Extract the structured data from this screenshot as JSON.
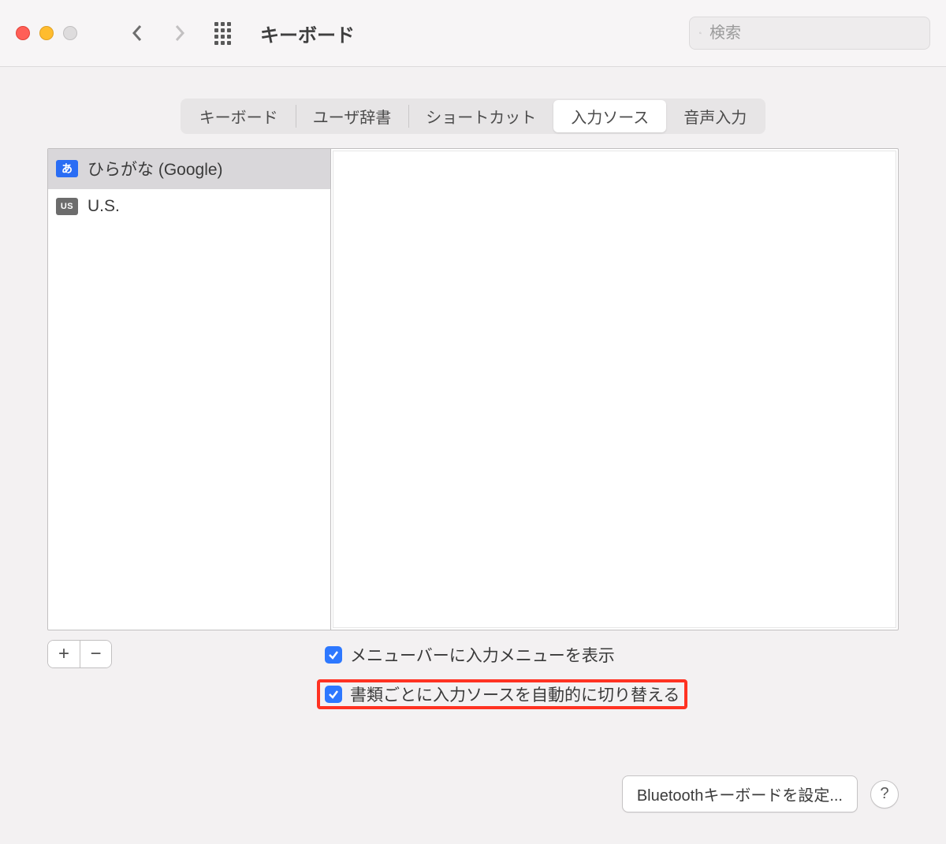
{
  "window": {
    "title": "キーボード"
  },
  "search": {
    "placeholder": "検索"
  },
  "tabs": [
    {
      "label": "キーボード",
      "active": false
    },
    {
      "label": "ユーザ辞書",
      "active": false
    },
    {
      "label": "ショートカット",
      "active": false
    },
    {
      "label": "入力ソース",
      "active": true
    },
    {
      "label": "音声入力",
      "active": false
    }
  ],
  "input_sources": [
    {
      "label": "ひらがな (Google)",
      "icon_text": "あ",
      "icon_kind": "jp",
      "selected": true
    },
    {
      "label": "U.S.",
      "icon_text": "US",
      "icon_kind": "us",
      "selected": false
    }
  ],
  "buttons": {
    "add": "+",
    "remove": "−"
  },
  "options": {
    "show_input_menu": {
      "label": "メニューバーに入力メニューを表示",
      "checked": true,
      "highlighted": false
    },
    "auto_switch_per_doc": {
      "label": "書類ごとに入力ソースを自動的に切り替える",
      "checked": true,
      "highlighted": true
    }
  },
  "footer": {
    "bluetooth": "Bluetoothキーボードを設定...",
    "help": "?"
  }
}
